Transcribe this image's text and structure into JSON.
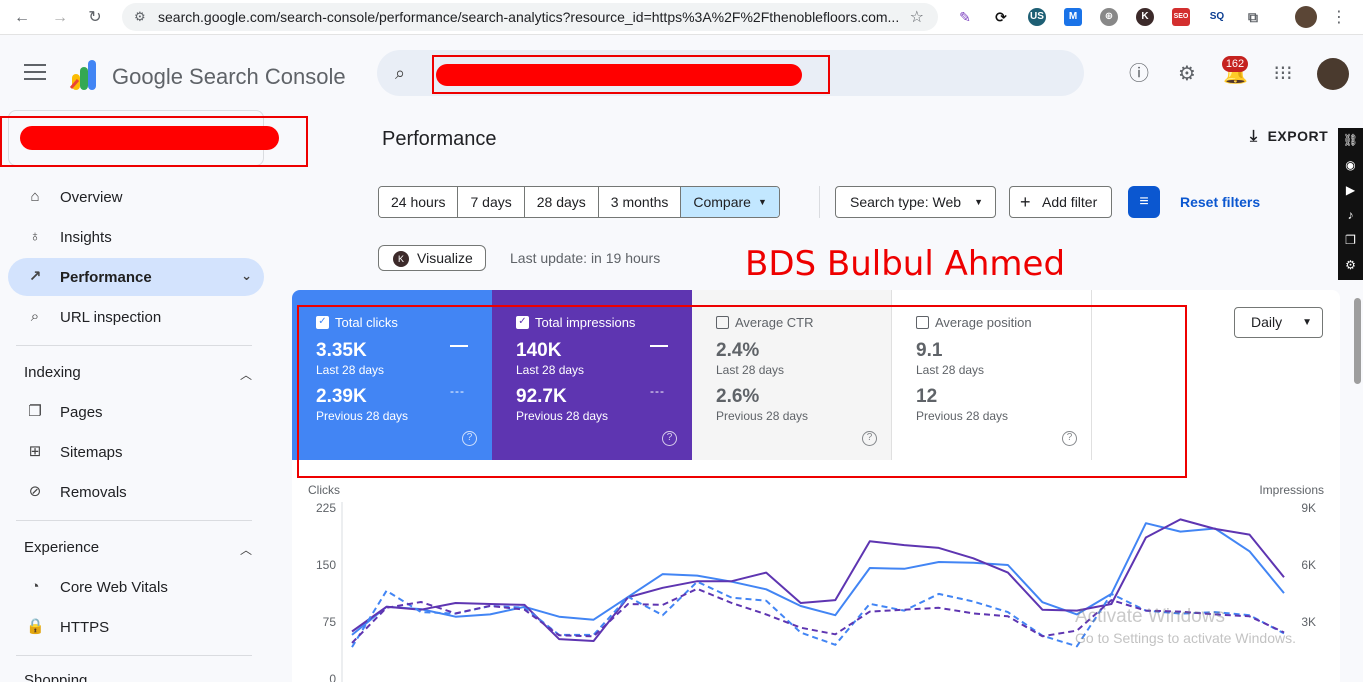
{
  "browser": {
    "url": "search.google.com/search-console/performance/search-analytics?resource_id=https%3A%2F%2Fthenoblefloors.com...",
    "ext_badge": "US"
  },
  "header": {
    "app_name": "Google Search Console",
    "search_placeholder": "",
    "notification_count": "162"
  },
  "sidebar": {
    "items_top": [
      {
        "label": "Overview",
        "icon": "home-icon"
      },
      {
        "label": "Insights",
        "icon": "bulb-icon"
      },
      {
        "label": "Performance",
        "icon": "trending-icon",
        "active": true
      },
      {
        "label": "URL inspection",
        "icon": "search-icon"
      }
    ],
    "section_indexing": "Indexing",
    "items_indexing": [
      {
        "label": "Pages",
        "icon": "pages-icon"
      },
      {
        "label": "Sitemaps",
        "icon": "sitemap-icon"
      },
      {
        "label": "Removals",
        "icon": "eye-off-icon"
      }
    ],
    "section_experience": "Experience",
    "items_experience": [
      {
        "label": "Core Web Vitals",
        "icon": "gauge-icon"
      },
      {
        "label": "HTTPS",
        "icon": "lock-icon"
      }
    ],
    "section_shopping": "Shopping"
  },
  "main": {
    "title": "Performance",
    "export_label": "EXPORT",
    "ranges": [
      "24 hours",
      "7 days",
      "28 days",
      "3 months",
      "Compare"
    ],
    "active_range": "Compare",
    "search_type": "Search type: Web",
    "add_filter": "Add filter",
    "reset_filters": "Reset filters",
    "visualize": "Visualize",
    "visualize_badge": "K",
    "last_update": "Last update: in 19 hours",
    "overlay_name": "BDS Bulbul Ahmed",
    "granularity": "Daily"
  },
  "cards": [
    {
      "title": "Total clicks",
      "checked": true,
      "current": "3.35K",
      "current_label": "Last 28 days",
      "previous": "2.39K",
      "previous_label": "Previous 28 days"
    },
    {
      "title": "Total impressions",
      "checked": true,
      "current": "140K",
      "current_label": "Last 28 days",
      "previous": "92.7K",
      "previous_label": "Previous 28 days"
    },
    {
      "title": "Average CTR",
      "checked": false,
      "current": "2.4%",
      "current_label": "Last 28 days",
      "previous": "2.6%",
      "previous_label": "Previous 28 days"
    },
    {
      "title": "Average position",
      "checked": false,
      "current": "9.1",
      "current_label": "Last 28 days",
      "previous": "12",
      "previous_label": "Previous 28 days"
    }
  ],
  "windows_watermark": {
    "line1": "Activate Windows",
    "line2": "Go to Settings to activate Windows."
  },
  "colors": {
    "clicks": "#4285f4",
    "impressions": "#5e35b1",
    "accent": "#0b57d0",
    "redaction": "#ff0000"
  },
  "chart_data": {
    "type": "line",
    "ylabel_left": "Clicks",
    "ylabel_right": "Impressions",
    "yticks_left": [
      "225",
      "150",
      "75",
      "0"
    ],
    "yticks_right": [
      "9K",
      "6K",
      "3K"
    ],
    "ylim_left": [
      0,
      225
    ],
    "ylim_right": [
      0,
      9000
    ],
    "x": [
      1,
      2,
      3,
      4,
      5,
      6,
      7,
      8,
      9,
      10,
      11,
      12,
      13,
      14,
      15,
      16,
      17,
      18,
      19,
      20,
      21,
      22,
      23,
      24,
      25,
      26,
      27,
      28
    ],
    "series": [
      {
        "name": "Clicks (Last 28 days)",
        "axis": "left",
        "dash": false,
        "color": "#4285f4",
        "values": [
          58,
          95,
          92,
          82,
          85,
          95,
          82,
          78,
          108,
          138,
          136,
          128,
          118,
          96,
          84,
          146,
          145,
          154,
          153,
          150,
          101,
          85,
          112,
          205,
          194,
          198,
          168,
          113
        ]
      },
      {
        "name": "Impressions (Last 28 days)",
        "axis": "right",
        "dash": false,
        "color": "#5e35b1",
        "values": [
          2500,
          3800,
          3650,
          4000,
          3950,
          3900,
          2100,
          2000,
          4300,
          4800,
          5150,
          5150,
          5600,
          4000,
          4150,
          7250,
          7050,
          6900,
          6350,
          5600,
          3650,
          3600,
          3950,
          7450,
          8400,
          7900,
          7600,
          5350
        ]
      },
      {
        "name": "Clicks (Previous 28 days)",
        "axis": "left",
        "dash": true,
        "color": "#4285f4",
        "values": [
          42,
          116,
          88,
          86,
          96,
          94,
          58,
          58,
          108,
          84,
          128,
          107,
          103,
          61,
          45,
          99,
          90,
          112,
          102,
          88,
          57,
          43,
          112,
          90,
          86,
          88,
          84,
          60
        ]
      },
      {
        "name": "Impressions (Previous 28 days)",
        "axis": "right",
        "dash": true,
        "color": "#5e35b1",
        "values": [
          1900,
          3750,
          4050,
          3450,
          3850,
          3650,
          2300,
          2250,
          3950,
          3900,
          4750,
          4000,
          3400,
          2700,
          2350,
          3550,
          3650,
          3750,
          3450,
          3300,
          2250,
          2550,
          4150,
          3600,
          3550,
          3400,
          3300,
          2450
        ]
      }
    ]
  }
}
